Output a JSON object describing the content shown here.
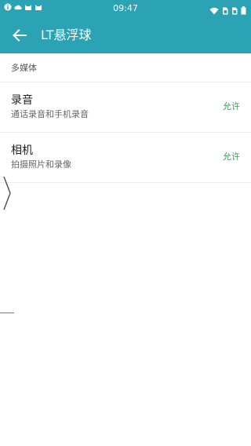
{
  "status_bar": {
    "time": "09:47",
    "left_icons": [
      "info-icon",
      "cloud-icon",
      "cat-icon",
      "cat-icon"
    ],
    "right_icons": [
      "wifi-icon",
      "sim-icon",
      "sim-icon",
      "battery-icon"
    ]
  },
  "app_bar": {
    "title": "LT悬浮球",
    "back_icon": "arrow-left-icon",
    "background_color": "#2ba3b4"
  },
  "section": {
    "header": "多媒体"
  },
  "permissions": [
    {
      "title": "录音",
      "description": "通话录音和手机录音",
      "status": "允许"
    },
    {
      "title": "相机",
      "description": "拍摄照片和录像",
      "status": "允许"
    }
  ],
  "colors": {
    "accent": "#2ba3b4",
    "allowed": "#3b9e58"
  }
}
